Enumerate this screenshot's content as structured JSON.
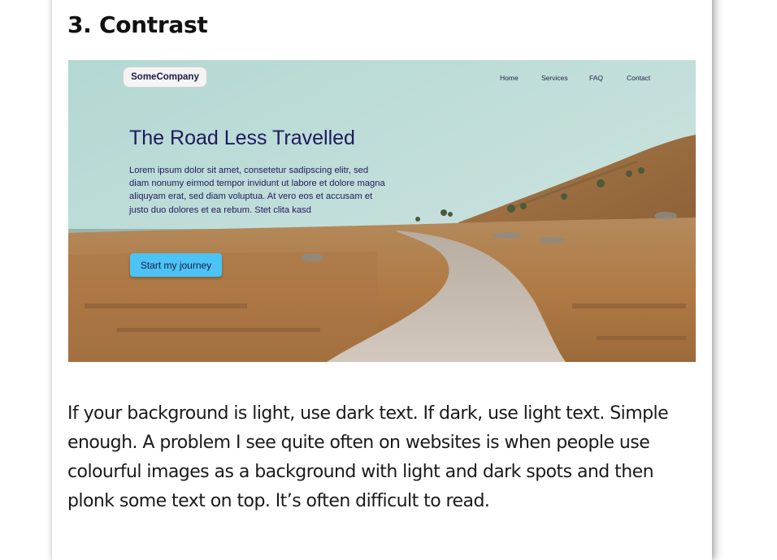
{
  "section": {
    "heading": "3. Contrast",
    "body": "If your background is light, use dark text. If dark, use light text. Simple enough. A problem I see quite often on websites is when people use colourful images as a background with light and dark spots and then plonk some text on top. It’s often difficult to read."
  },
  "mockup": {
    "logo": "SomeCompany",
    "nav": [
      "Home",
      "Services",
      "FAQ",
      "Contact"
    ],
    "hero": {
      "title": "The Road Less Travelled",
      "text": "Lorem ipsum dolor sit amet, consetetur sadipscing elitr, sed diam nonumy eirmod tempor invidunt ut labore et dolore magna aliquyam erat, sed diam voluptua. At vero eos et accusam et justo duo dolores et ea rebum. Stet clita kasd",
      "cta": "Start my journey"
    },
    "colors": {
      "sky": "#bcdcd8",
      "grass": "#b98552",
      "road": "#c8bfb3",
      "title_text": "#1f1a5c",
      "cta_bg": "#4cc3f5"
    }
  }
}
